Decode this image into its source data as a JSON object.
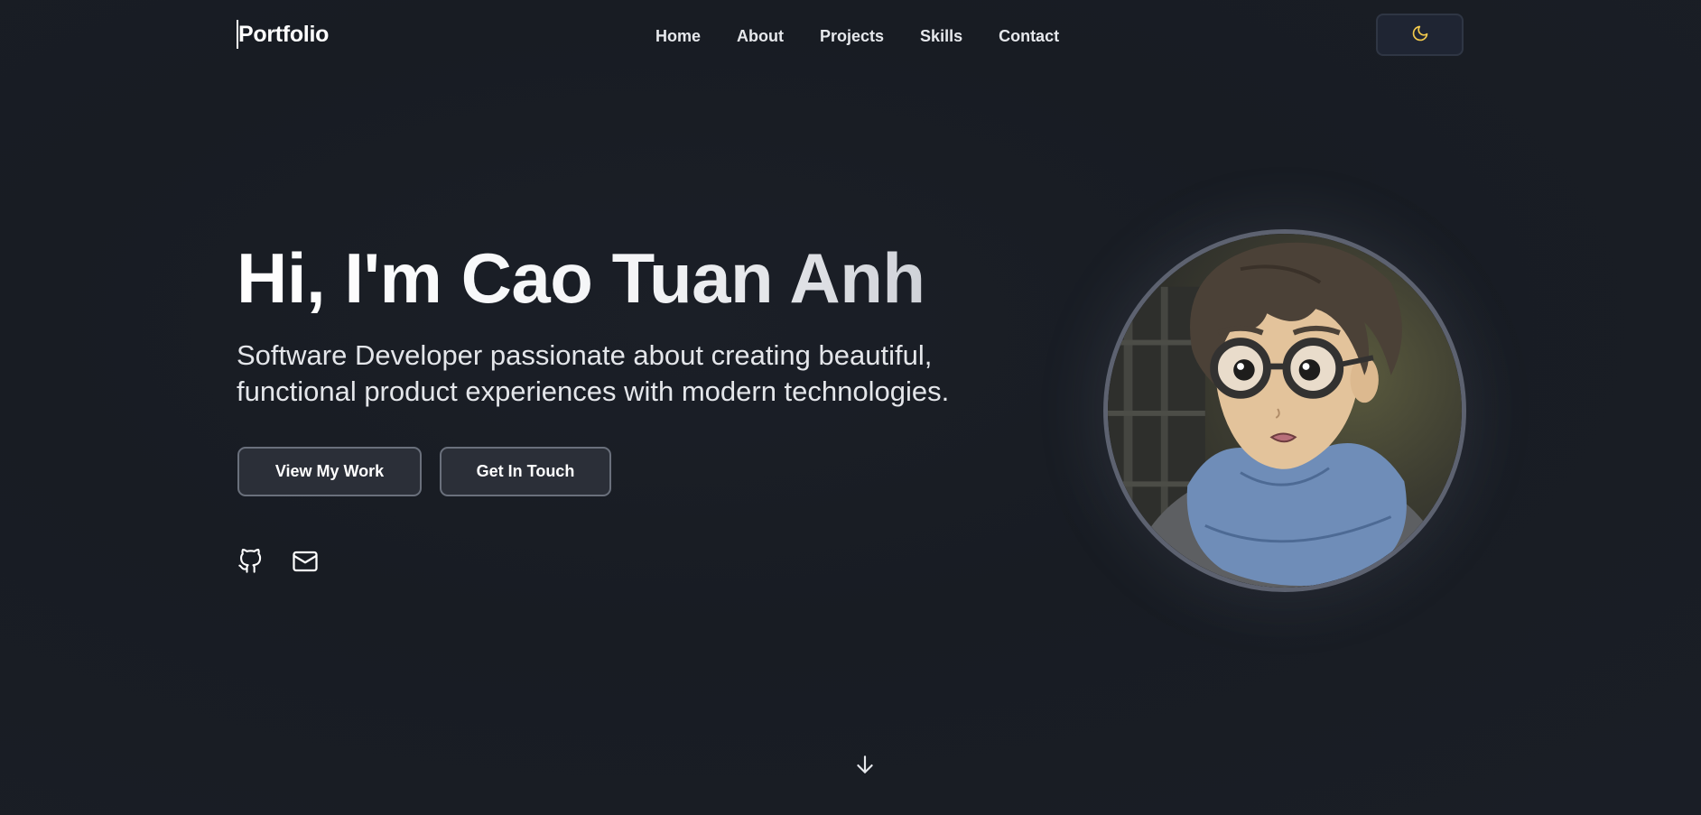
{
  "header": {
    "brand": "Portfolio",
    "nav": [
      {
        "label": "Home"
      },
      {
        "label": "About"
      },
      {
        "label": "Projects"
      },
      {
        "label": "Skills"
      },
      {
        "label": "Contact"
      }
    ],
    "theme_toggle_icon": "moon-icon"
  },
  "hero": {
    "title": "Hi, I'm Cao Tuan Anh",
    "subtitle": "Software Developer passionate about creating beautiful, functional product experiences with modern technologies.",
    "primary_button": "View My Work",
    "secondary_button": "Get In Touch",
    "socials": [
      {
        "icon": "github-icon"
      },
      {
        "icon": "mail-icon"
      }
    ],
    "avatar_icon": "profile-avatar-illustration"
  },
  "footer": {
    "scroll_icon": "arrow-down-icon"
  },
  "colors": {
    "background": "#1a1e26",
    "accent_moon": "#f2c94c",
    "button_bg": "#2b2f38",
    "button_border": "#6a707c",
    "scarf_blue": "#6f8db8"
  }
}
